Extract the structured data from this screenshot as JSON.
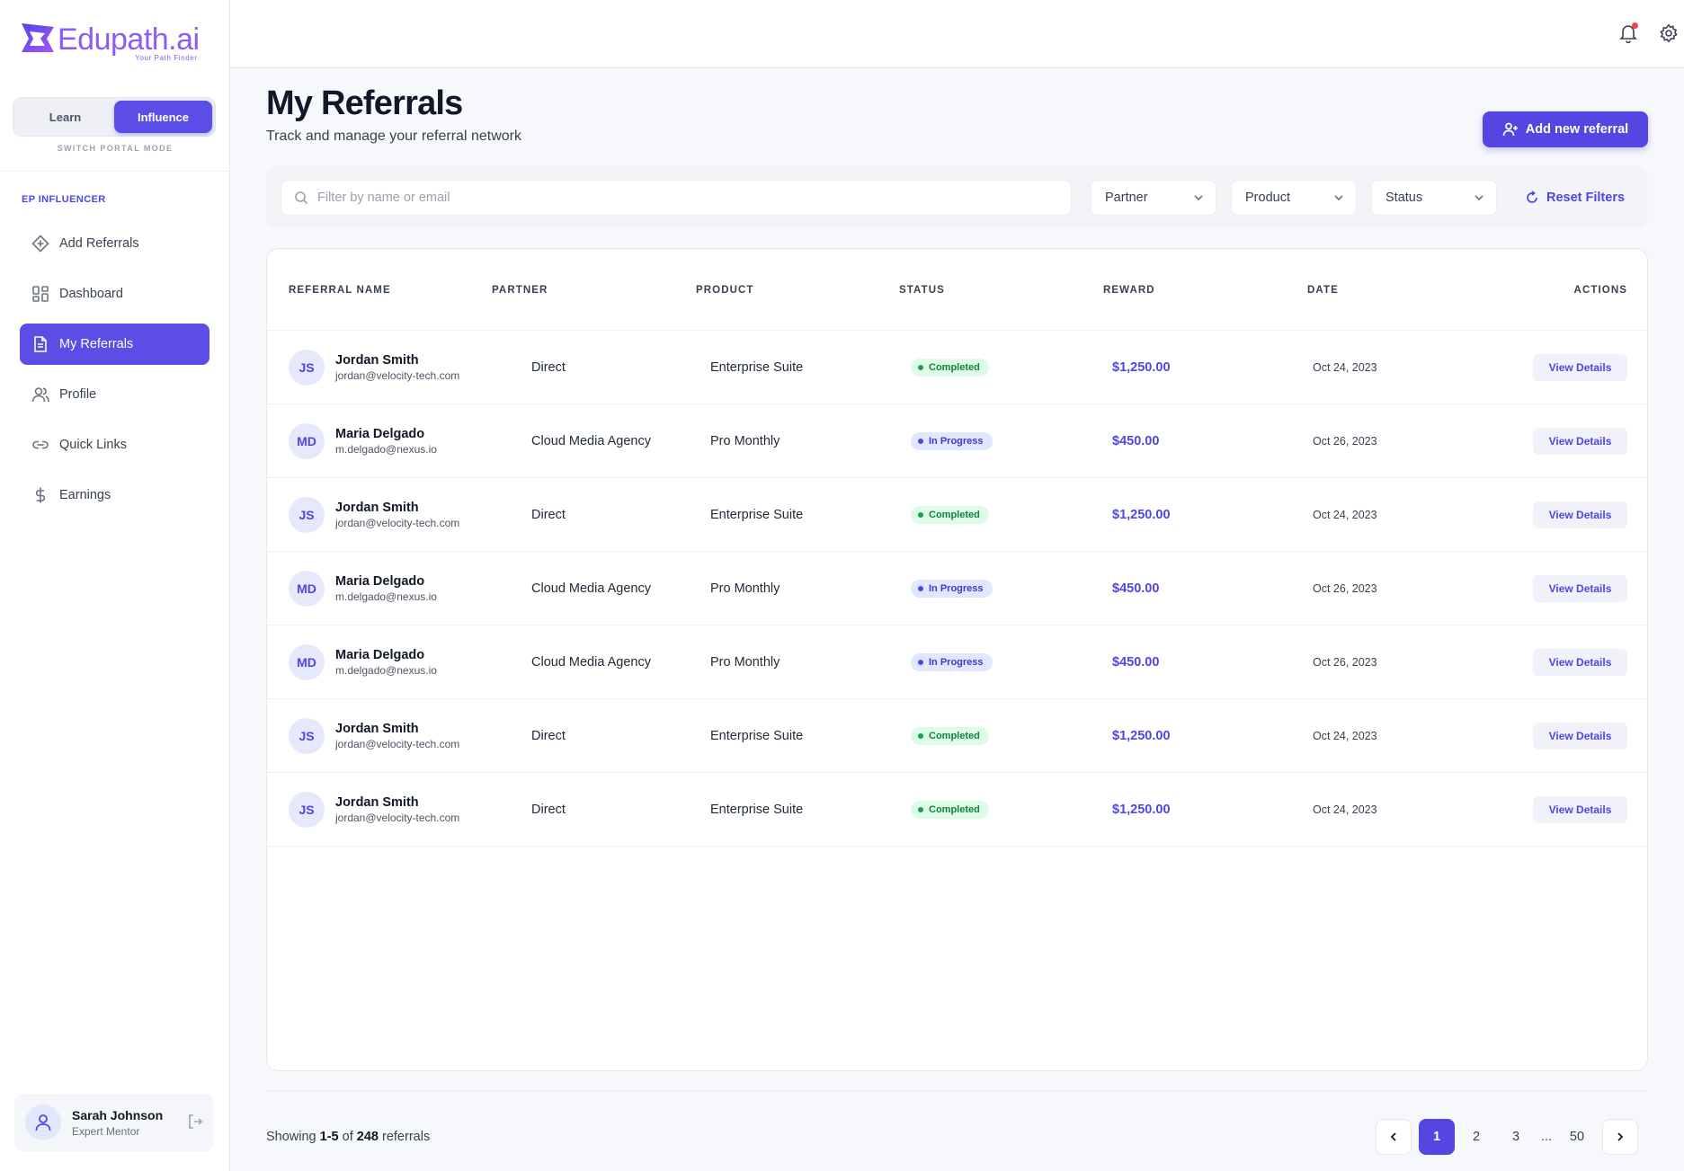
{
  "brand": {
    "name": "Edupath.ai",
    "tagline": "Your Path Finder",
    "accent_color": "#5446e2"
  },
  "mode_switch": {
    "options": [
      "Learn",
      "Influence"
    ],
    "selected": "Influence",
    "caption": "SWITCH PORTAL MODE"
  },
  "sidebar": {
    "section_label": "EP INFLUENCER",
    "items": [
      {
        "label": "Add Referrals",
        "icon": "diamond-plus-icon"
      },
      {
        "label": "Dashboard",
        "icon": "dashboard-grid-icon"
      },
      {
        "label": "My Referrals",
        "icon": "document-icon",
        "active": true
      },
      {
        "label": "Profile",
        "icon": "users-icon"
      },
      {
        "label": "Quick Links",
        "icon": "link-icon"
      },
      {
        "label": "Earnings",
        "icon": "dollar-icon"
      }
    ]
  },
  "user": {
    "name": "Sarah Johnson",
    "role": "Expert Mentor"
  },
  "header": {
    "title": "My Referrals",
    "subtitle": "Track and manage your referral network",
    "add_button": "Add new referral"
  },
  "filters": {
    "search_placeholder": "Filter by name or email",
    "partner": "Partner",
    "product": "Product",
    "status": "Status",
    "reset": "Reset Filters"
  },
  "table": {
    "columns": [
      "REFERRAL NAME",
      "PARTNER",
      "PRODUCT",
      "STATUS",
      "REWARD",
      "DATE",
      "ACTIONS"
    ],
    "rows": [
      {
        "initials": "JS",
        "name": "Jordan Smith",
        "email": "jordan@velocity-tech.com",
        "partner": "Direct",
        "product": "Enterprise Suite",
        "status": "Completed",
        "reward": "$1,250.00",
        "date": "Oct 24, 2023",
        "action": "View Details"
      },
      {
        "initials": "MD",
        "name": "Maria Delgado",
        "email": "m.delgado@nexus.io",
        "partner": "Cloud Media Agency",
        "product": "Pro Monthly",
        "status": "In Progress",
        "reward": "$450.00",
        "date": "Oct 26, 2023",
        "action": "View Details"
      },
      {
        "initials": "JS",
        "name": "Jordan Smith",
        "email": "jordan@velocity-tech.com",
        "partner": "Direct",
        "product": "Enterprise Suite",
        "status": "Completed",
        "reward": "$1,250.00",
        "date": "Oct 24, 2023",
        "action": "View Details"
      },
      {
        "initials": "MD",
        "name": "Maria Delgado",
        "email": "m.delgado@nexus.io",
        "partner": "Cloud Media Agency",
        "product": "Pro Monthly",
        "status": "In Progress",
        "reward": "$450.00",
        "date": "Oct 26, 2023",
        "action": "View Details"
      },
      {
        "initials": "MD",
        "name": "Maria Delgado",
        "email": "m.delgado@nexus.io",
        "partner": "Cloud Media Agency",
        "product": "Pro Monthly",
        "status": "In Progress",
        "reward": "$450.00",
        "date": "Oct 26, 2023",
        "action": "View Details"
      },
      {
        "initials": "JS",
        "name": "Jordan Smith",
        "email": "jordan@velocity-tech.com",
        "partner": "Direct",
        "product": "Enterprise Suite",
        "status": "Completed",
        "reward": "$1,250.00",
        "date": "Oct 24, 2023",
        "action": "View Details"
      },
      {
        "initials": "JS",
        "name": "Jordan Smith",
        "email": "jordan@velocity-tech.com",
        "partner": "Direct",
        "product": "Enterprise Suite",
        "status": "Completed",
        "reward": "$1,250.00",
        "date": "Oct 24, 2023",
        "action": "View Details"
      }
    ]
  },
  "footer": {
    "showing_prefix": "Showing ",
    "range": "1-5",
    "of_text": " of ",
    "total": "248",
    "suffix": " referrals"
  },
  "pagination": {
    "pages": [
      "1",
      "2",
      "3",
      "...",
      "50"
    ],
    "current": "1"
  }
}
